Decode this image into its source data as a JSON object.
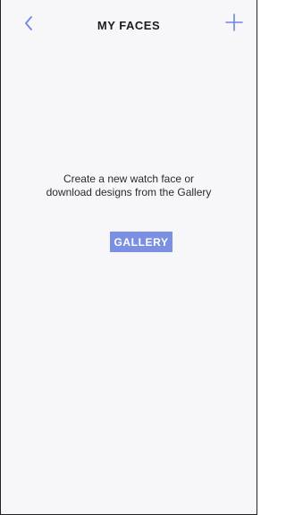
{
  "header": {
    "title": "MY FACES",
    "back_icon": "chevron-left-icon",
    "add_icon": "plus-icon"
  },
  "empty_state": {
    "line1": "Create a new watch face or",
    "line2": "download designs from the Gallery"
  },
  "actions": {
    "gallery_label": "GALLERY"
  },
  "colors": {
    "accent": "#7b90e2",
    "background": "#f7f7f9"
  }
}
